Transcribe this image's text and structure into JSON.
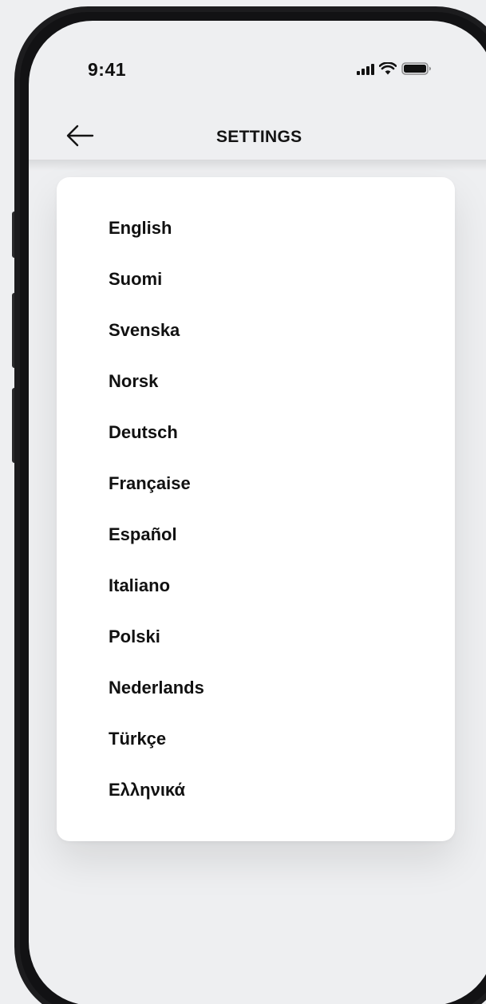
{
  "status_bar": {
    "time": "9:41",
    "icons": [
      "signal-icon",
      "wifi-icon",
      "battery-icon"
    ]
  },
  "header": {
    "back_icon": "arrow-left-icon",
    "title": "SETTINGS"
  },
  "languages": [
    "English",
    "Suomi",
    "Svenska",
    "Norsk",
    "Deutsch",
    "Française",
    "Español",
    "Italiano",
    "Polski",
    "Nederlands",
    "Türkçe",
    "Ελληνικά"
  ],
  "colors": {
    "background": "#eeeff1",
    "card": "#ffffff",
    "text": "#111111",
    "phone_frame": "#1c1c1e"
  }
}
